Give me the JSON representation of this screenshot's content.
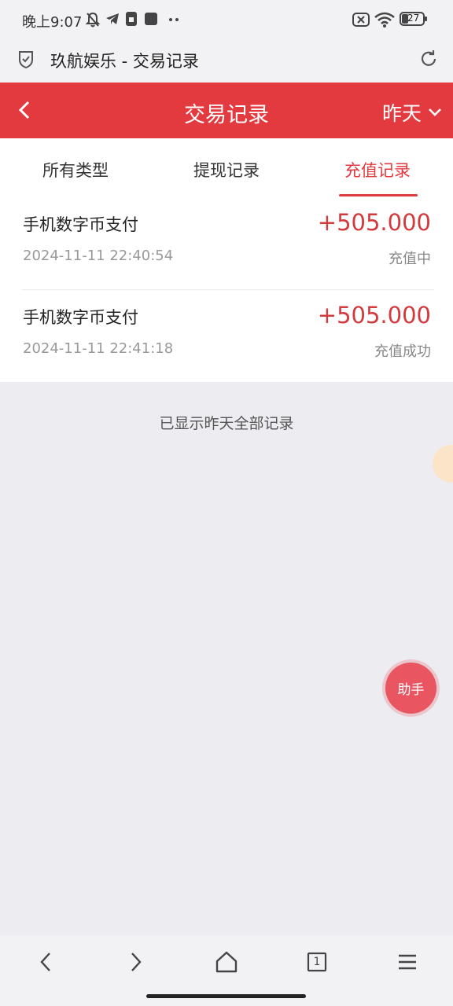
{
  "status_bar": {
    "time": "晚上9:07",
    "battery": "27"
  },
  "browser": {
    "page_title": "玖航娱乐 - 交易记录"
  },
  "header": {
    "title": "交易记录",
    "period": "昨天"
  },
  "tabs": [
    {
      "label": "所有类型",
      "active": false
    },
    {
      "label": "提现记录",
      "active": false
    },
    {
      "label": "充值记录",
      "active": true
    }
  ],
  "records": [
    {
      "title": "手机数字币支付",
      "amount": "+505.000",
      "time": "2024-11-11 22:40:54",
      "status": "充值中"
    },
    {
      "title": "手机数字币支付",
      "amount": "+505.000",
      "time": "2024-11-11 22:41:18",
      "status": "充值成功"
    }
  ],
  "footer_note": "已显示昨天全部记录",
  "assistant": {
    "label": "助手"
  },
  "bottom_nav": {
    "tab_count": "1"
  },
  "colors": {
    "accent": "#e33a40",
    "amount": "#d23a3e",
    "background": "#edecf1"
  }
}
